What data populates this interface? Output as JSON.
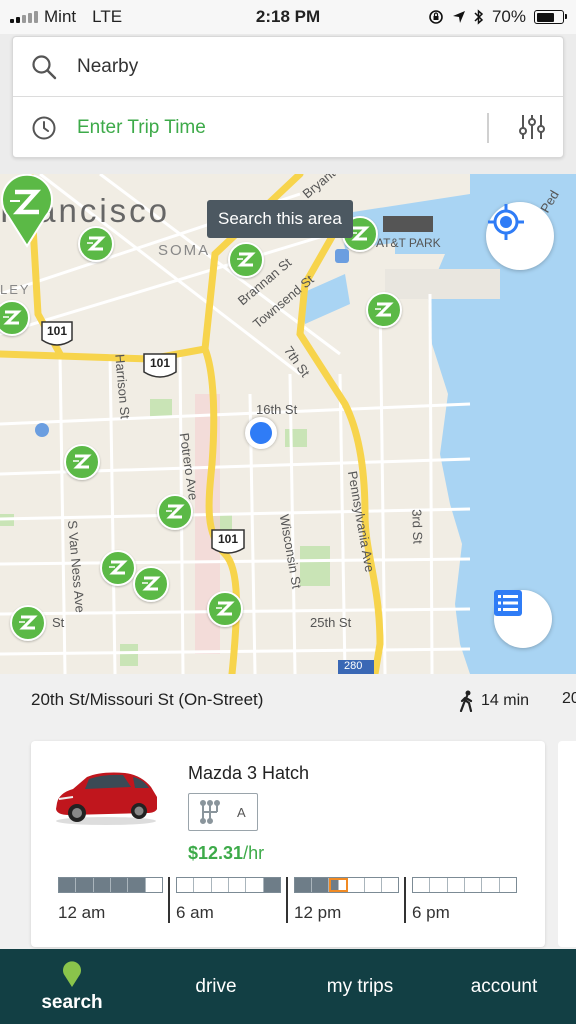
{
  "status_bar": {
    "carrier": "Mint",
    "network": "LTE",
    "time": "2:18 PM",
    "battery": "70%",
    "battery_level": 0.7
  },
  "search": {
    "location": "Nearby",
    "trip_time": "Enter Trip Time"
  },
  "map": {
    "tooltip": "Search this area",
    "labels": {
      "francisco": "Francisco",
      "soma": "SOMA",
      "att_park": "AT&T PARK",
      "brannan": "Brannan St",
      "townsend": "Townsend St",
      "seventh": "7th St",
      "sixteenth": "16th St",
      "harrison": "Harrison St",
      "potrero": "Potrero Ave",
      "wisconsin": "Wisconsin St",
      "pennsylvania": "Pennsylvania Ave",
      "third": "3rd St",
      "s_van_ness": "S Van Ness Ave",
      "twentyfifth": "25th St",
      "st": "St",
      "ley": "LEY",
      "hwy101": "101",
      "hwy280": "280",
      "bryant": "Bryant",
      "ped": "Ped"
    }
  },
  "listing": {
    "address": "20th St/Missouri St (On-Street)",
    "walk_time": "14 min",
    "next_peek": "20",
    "car_name": "Mazda 3 Hatch",
    "transmission": "A",
    "price": "$12.31",
    "price_unit": "/hr",
    "time_labels": [
      "12 am",
      "6 am",
      "12 pm",
      "6 pm"
    ]
  },
  "tabs": [
    {
      "label": "search"
    },
    {
      "label": "drive"
    },
    {
      "label": "my trips"
    },
    {
      "label": "account"
    }
  ],
  "colors": {
    "accent_green": "#3daa49",
    "tab_bar": "#123f44",
    "user_dot": "#2f7cf6",
    "tooltip": "#4c5861"
  }
}
